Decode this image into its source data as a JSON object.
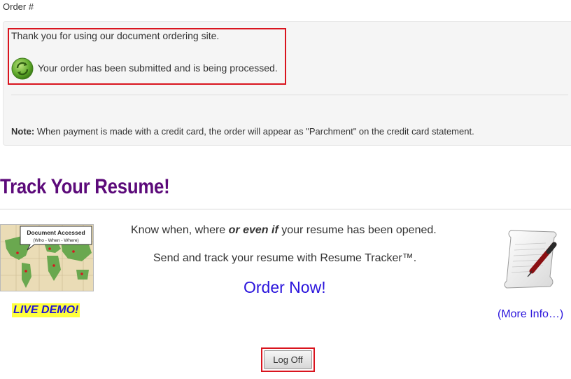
{
  "order": {
    "label": "Order #"
  },
  "confirmation": {
    "thanks": "Thank you for using our document ordering site.",
    "status": "Your order has been submitted and is being processed.",
    "note_label": "Note:",
    "note_text": " When payment is made with a credit card, the order will appear as \"Parchment\" on the credit card statement."
  },
  "tracker": {
    "heading": "Track Your Resume!",
    "line1_a": "Know when, where ",
    "line1_em": "or even if",
    "line1_b": " your resume has been opened.",
    "line2": "Send and track your resume with Resume Tracker™.",
    "order_now": "Order Now!",
    "live_demo": "LIVE DEMO!",
    "more_info": "(More Info…)",
    "map_callout_title": "Document Accessed",
    "map_callout_sub": "(Who - When - Where)"
  },
  "logoff": {
    "label": "Log Off"
  },
  "colors": {
    "heading": "#5c0a7a",
    "link": "#2a14dc",
    "highlight": "#d9141e",
    "demo_bg": "#ffff3d"
  },
  "icons": {
    "status": "processing-icon",
    "map": "world-map-icon",
    "scroll": "scroll-pen-icon"
  }
}
